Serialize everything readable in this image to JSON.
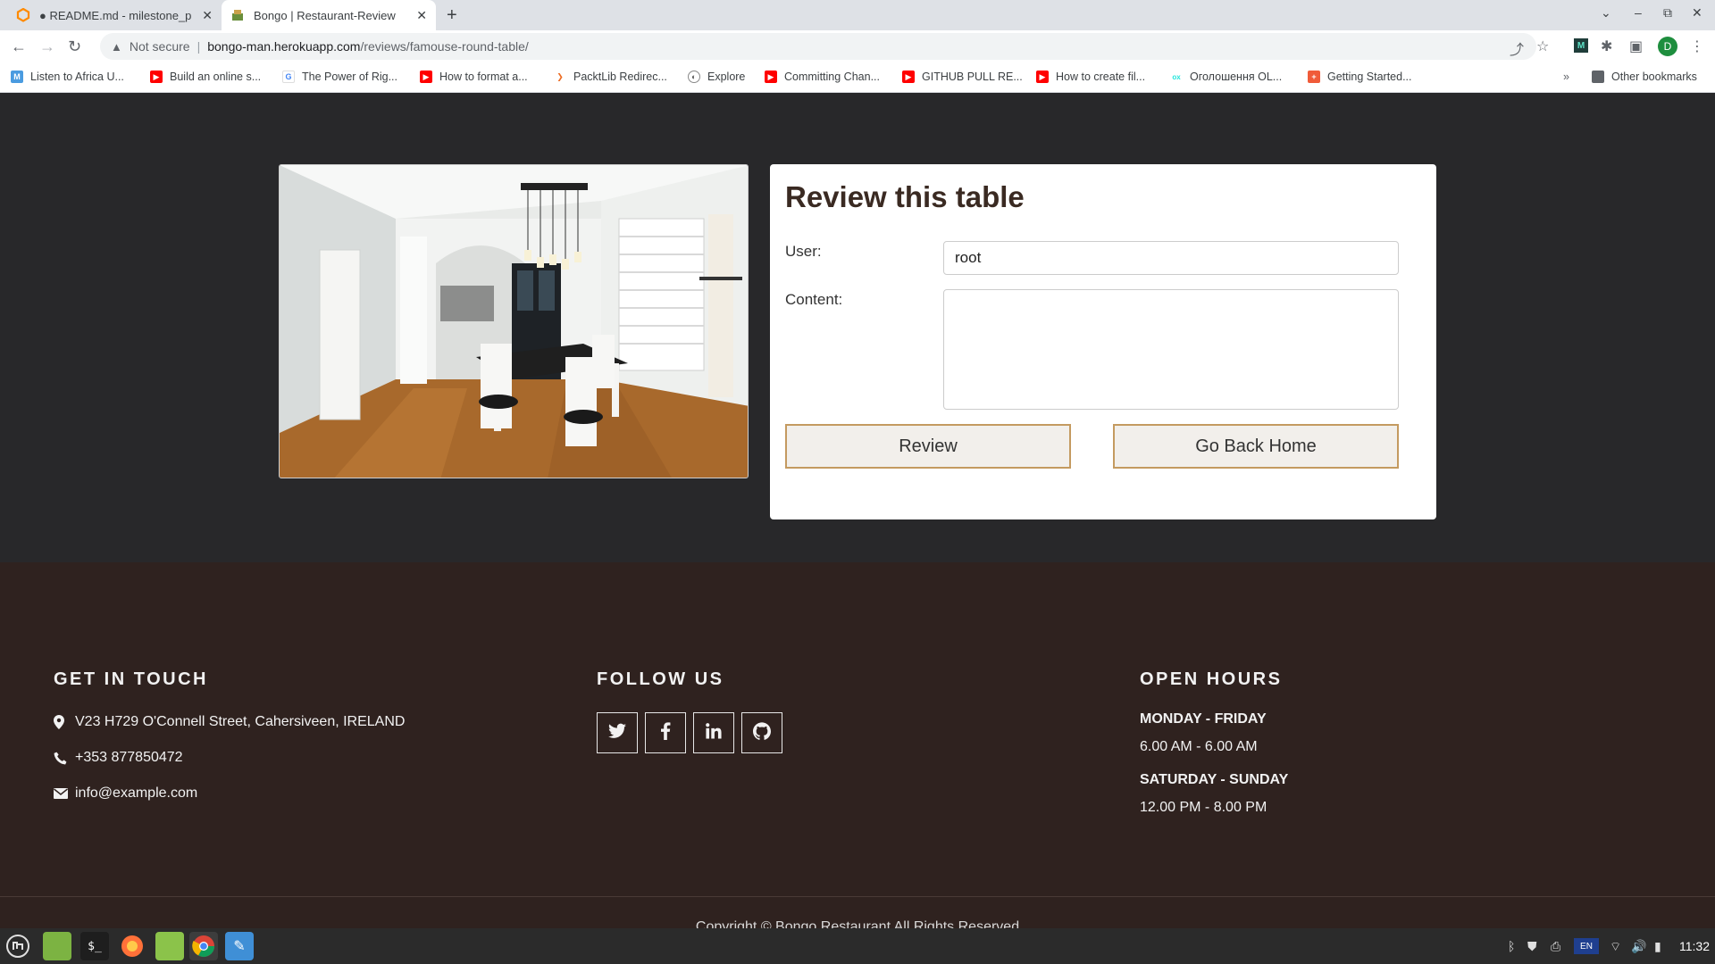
{
  "browser": {
    "tabs": [
      {
        "title": "● README.md - milestone_pr",
        "active": false
      },
      {
        "title": "Bongo | Restaurant-Review",
        "active": true
      }
    ],
    "security_label": "Not secure",
    "url_host": "bongo-man.herokuapp.com",
    "url_path": "/reviews/famouse-round-table/",
    "profile_initial": "D",
    "bookmarks": [
      "Listen to Africa U...",
      "Build an online s...",
      "The Power of Rig...",
      "How to format a...",
      "PacktLib Redirec...",
      "Explore",
      "Committing Chan...",
      "GITHUB PULL RE...",
      "How to create fil...",
      "Оголошення OL...",
      "Getting Started..."
    ],
    "other_bookmarks": "Other bookmarks"
  },
  "review_form": {
    "title": "Review this table",
    "user_label": "User:",
    "user_value": "root",
    "content_label": "Content:",
    "content_value": "",
    "review_button": "Review",
    "home_button": "Go Back Home"
  },
  "footer": {
    "contact": {
      "heading": "GET IN TOUCH",
      "address": "V23 H729 O'Connell Street, Cahersiveen, IRELAND",
      "phone": "+353 877850472",
      "email": "info@example.com"
    },
    "follow": {
      "heading": "FOLLOW US",
      "networks": [
        "twitter",
        "facebook",
        "linkedin",
        "github"
      ]
    },
    "hours": {
      "heading": "OPEN HOURS",
      "weekday_label": "MONDAY - FRIDAY",
      "weekday_time": "6.00 AM - 6.00 AM",
      "weekend_label": "SATURDAY - SUNDAY",
      "weekend_time": "12.00 PM - 8.00 PM"
    },
    "copyright": "Copyright © Bongo Restaurant All Rights Reserved"
  },
  "taskbar": {
    "clock": "11:32",
    "language": "EN"
  },
  "colors": {
    "page_bg": "#28282a",
    "footer_bg": "#2f221f",
    "button_border": "#c49a60",
    "heading_text": "#3a2a22"
  }
}
